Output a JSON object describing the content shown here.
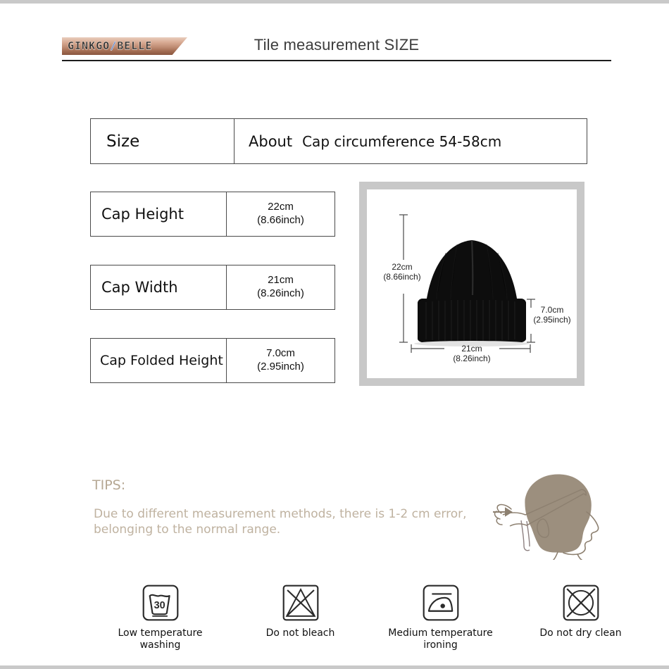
{
  "header": {
    "logo_text_left": "GINKGO",
    "logo_separator": "/",
    "logo_text_right": "BELLE",
    "title": "Tile measurement SIZE",
    "logo_gradient_top": "#e9cdbd",
    "logo_gradient_bottom": "#8a5740",
    "logo_slash_color": "#4a7fd4"
  },
  "size_summary": {
    "label": "Size",
    "about_word": "About",
    "description": "Cap circumference 54-58cm"
  },
  "measurements": [
    {
      "name": "Cap Height",
      "cm": "22cm",
      "inch": "(8.66inch)"
    },
    {
      "name": "Cap Width",
      "cm": "21cm",
      "inch": "(8.26inch)"
    },
    {
      "name": "Cap Folded Height",
      "cm": "7.0cm",
      "inch": "(2.95inch)"
    }
  ],
  "photo": {
    "alt_name": "black-knit-beanie",
    "frame_color": "#c8c8c8",
    "product_color": "#0d0d0d",
    "height_cm": "22cm",
    "height_inch": "(8.66inch)",
    "width_cm": "21cm",
    "width_inch": "(8.26inch)",
    "cuff_cm": "7.0cm",
    "cuff_inch": "(2.95inch)"
  },
  "tips": {
    "title": "TIPS:",
    "body": "Due to different measurement methods, there is 1-2 cm error, belonging to the normal range.",
    "text_color": "#bfb2a0",
    "figure_color": "#9c8f7e"
  },
  "care_instructions": [
    {
      "icon": "wash-tub-30-icon",
      "temperature": "30",
      "label": "Low temperature washing"
    },
    {
      "icon": "no-bleach-icon",
      "temperature": "",
      "label": "Do not bleach"
    },
    {
      "icon": "iron-one-dot-icon",
      "temperature": "",
      "label": "Medium temperature ironing"
    },
    {
      "icon": "no-dry-clean-icon",
      "temperature": "",
      "label": "Do not dry clean"
    }
  ],
  "page": {
    "edge_bar_color": "#c9c9c9"
  }
}
